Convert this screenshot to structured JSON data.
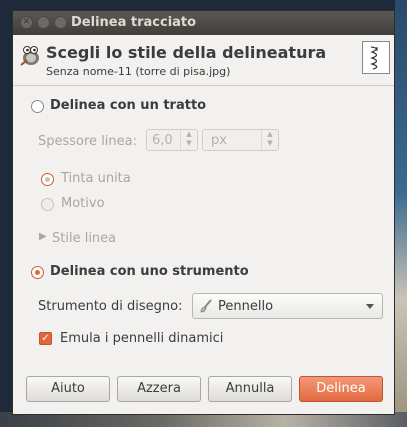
{
  "window": {
    "title": "Delinea tracciato"
  },
  "header": {
    "title": "Scegli lo stile della delineatura",
    "subtitle": "Senza nome-11 (torre di pisa.jpg)"
  },
  "stroke_line": {
    "label": "Delinea con un tratto",
    "selected": false,
    "width_label": "Spessore linea:",
    "width_value": "6,0",
    "unit_value": "px",
    "solid_label": "Tinta unita",
    "pattern_label": "Motivo",
    "line_style_label": "Stile linea"
  },
  "stroke_tool": {
    "label": "Delinea con uno strumento",
    "selected": true,
    "paint_tool_label": "Strumento di disegno:",
    "paint_tool_value": "Pennello",
    "emulate_label": "Emula i pennelli dinamici",
    "emulate_checked": true
  },
  "buttons": {
    "help": "Aiuto",
    "reset": "Azzera",
    "cancel": "Annulla",
    "stroke": "Delinea"
  },
  "colors": {
    "accent": "#e2683c",
    "titlebar": "#3f3e3a",
    "dialog_bg": "#f2f1f0"
  }
}
